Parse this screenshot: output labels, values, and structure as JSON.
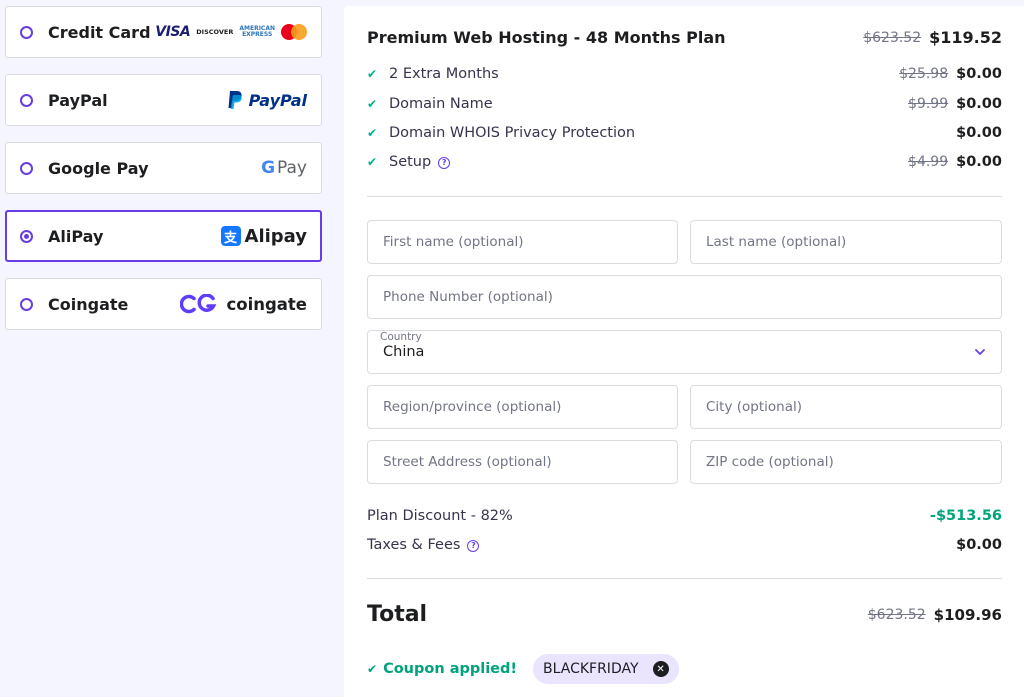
{
  "payment_methods": [
    {
      "label": "Credit Card",
      "logo": "visa-discover-amex-mastercard",
      "selected": false
    },
    {
      "label": "PayPal",
      "logo": "paypal",
      "logo_text": "PayPal",
      "selected": false
    },
    {
      "label": "Google Pay",
      "logo": "google-pay",
      "logo_text": "Pay",
      "selected": false
    },
    {
      "label": "AliPay",
      "logo": "alipay",
      "logo_text": "Alipay",
      "selected": true
    },
    {
      "label": "Coingate",
      "logo": "coingate",
      "logo_text": "coingate",
      "selected": false
    }
  ],
  "card_logos": {
    "visa": "VISA",
    "discover": "DISCOVER",
    "amex_top": "AMERICAN",
    "amex_bottom": "EXPRESS"
  },
  "summary": {
    "plan_name": "Premium Web Hosting - 48 Months Plan",
    "plan_old_price": "$623.52",
    "plan_price": "$119.52",
    "items": [
      {
        "name": "2 Extra Months",
        "old_price": "$25.98",
        "price": "$0.00",
        "help": false
      },
      {
        "name": "Domain Name",
        "old_price": "$9.99",
        "price": "$0.00",
        "help": false
      },
      {
        "name": "Domain WHOIS Privacy Protection",
        "old_price": "",
        "price": "$0.00",
        "help": false
      },
      {
        "name": "Setup",
        "old_price": "$4.99",
        "price": "$0.00",
        "help": true
      }
    ]
  },
  "form": {
    "first_name": {
      "placeholder": "First name (optional)",
      "value": ""
    },
    "last_name": {
      "placeholder": "Last name (optional)",
      "value": ""
    },
    "phone": {
      "placeholder": "Phone Number (optional)",
      "value": ""
    },
    "country": {
      "label": "Country",
      "value": "China"
    },
    "region": {
      "placeholder": "Region/province (optional)",
      "value": ""
    },
    "city": {
      "placeholder": "City (optional)",
      "value": ""
    },
    "street": {
      "placeholder": "Street Address (optional)",
      "value": ""
    },
    "zip": {
      "placeholder": "ZIP code (optional)",
      "value": ""
    }
  },
  "discount": {
    "label": "Plan Discount - 82%",
    "value": "-$513.56"
  },
  "taxes": {
    "label": "Taxes & Fees",
    "value": "$0.00"
  },
  "total": {
    "label": "Total",
    "old_price": "$623.52",
    "price": "$109.96"
  },
  "coupon": {
    "text": "Coupon applied!",
    "code": "BLACKFRIDAY"
  },
  "colors": {
    "accent": "#673de6",
    "success": "#00b090",
    "chip_bg": "#ebe4ff"
  }
}
